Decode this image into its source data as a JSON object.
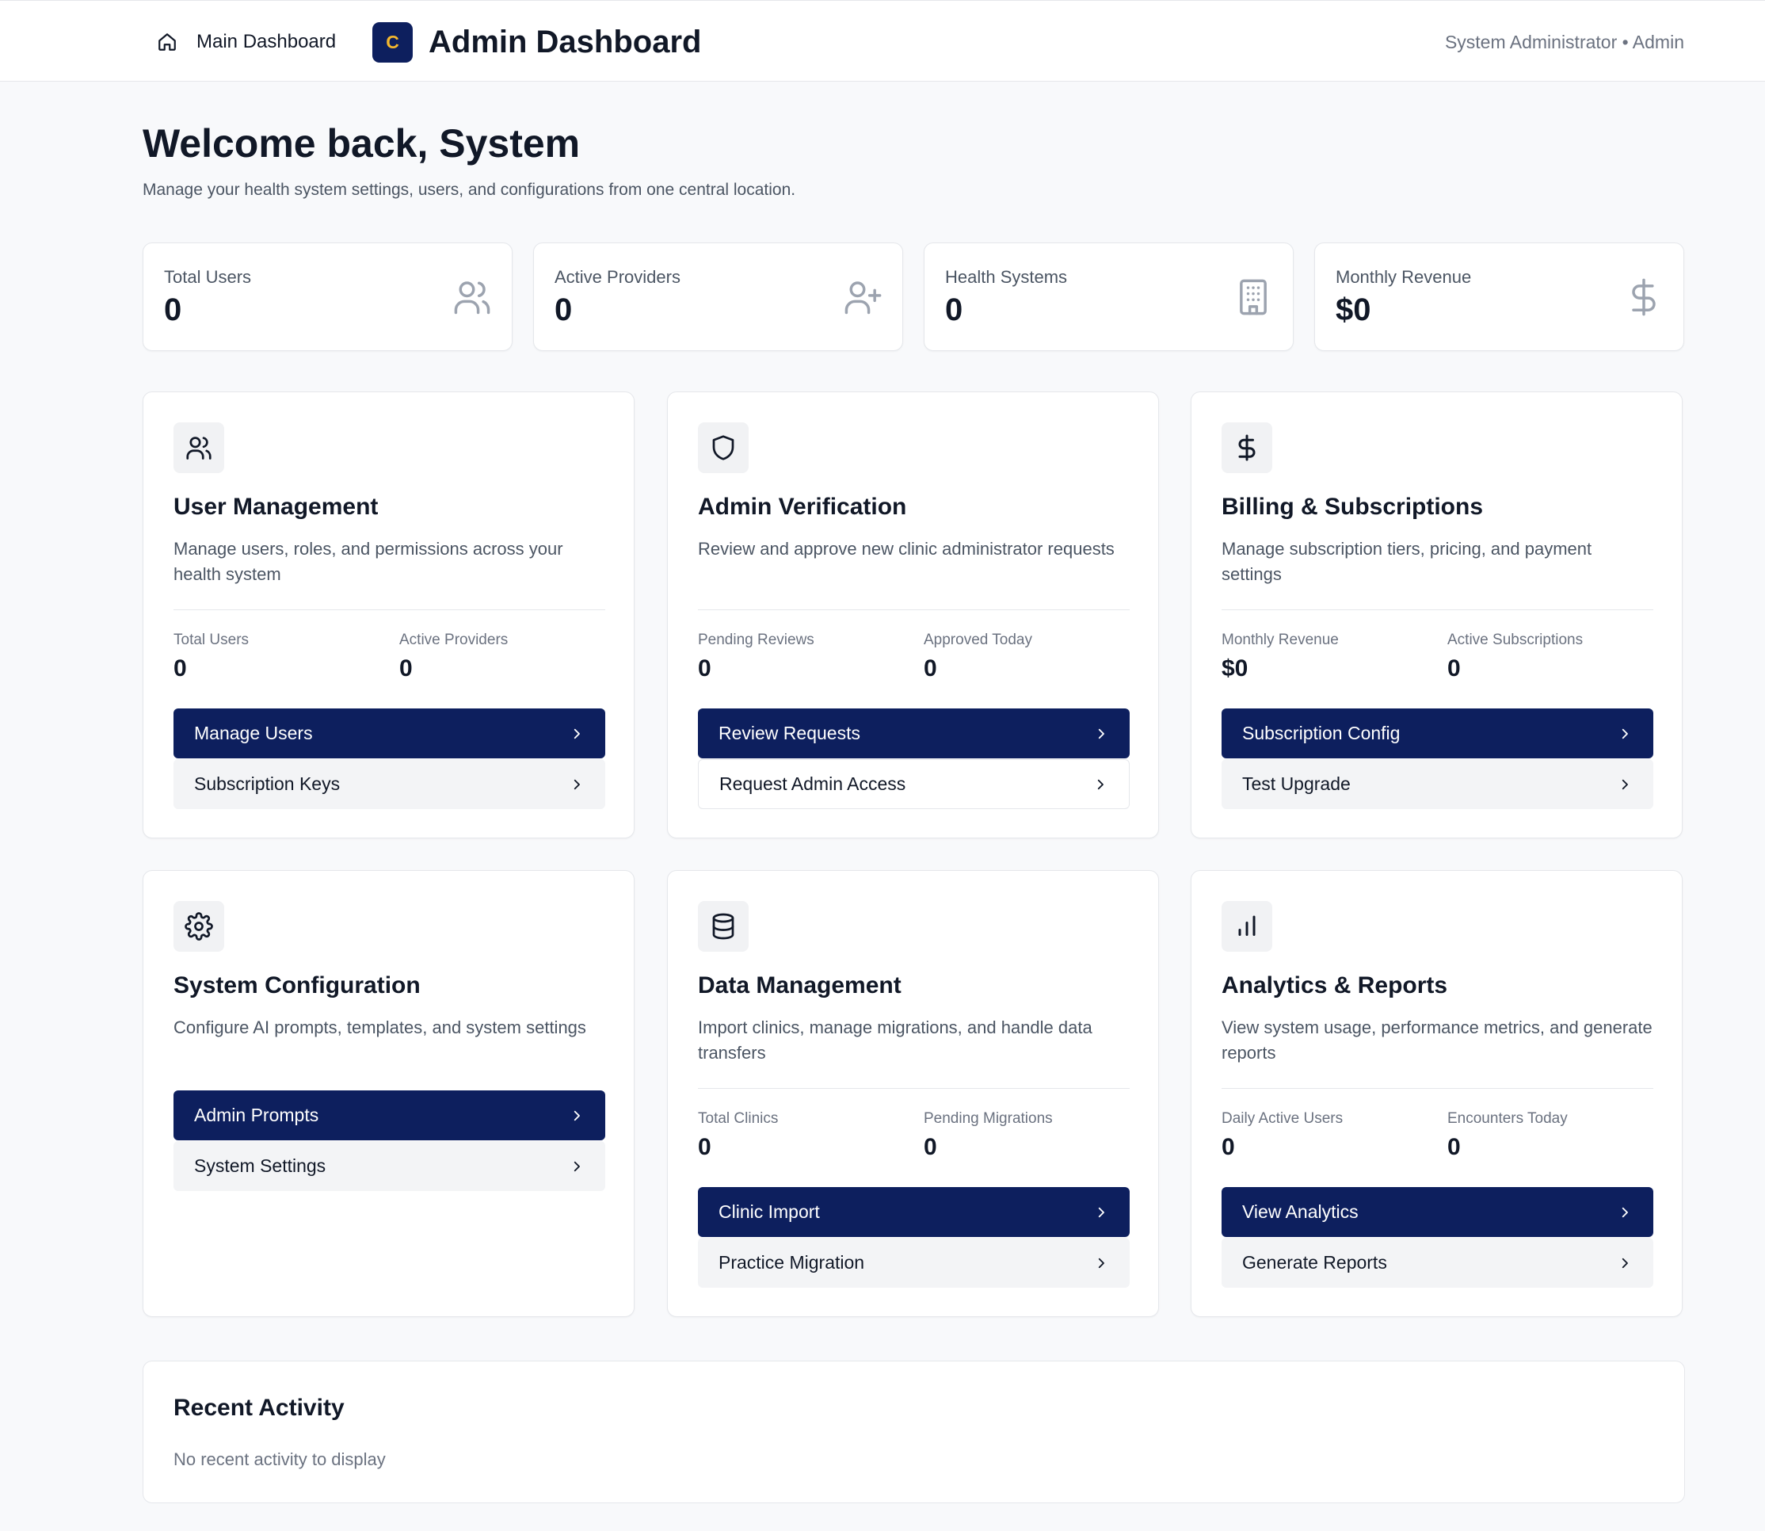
{
  "header": {
    "home_label": "Main Dashboard",
    "brand_letter": "C",
    "title": "Admin Dashboard",
    "user": "System Administrator • Admin",
    "brand_color": "#0d1f5e",
    "brand_letter_color": "#f5b82e"
  },
  "welcome": {
    "title": "Welcome back, System",
    "subtitle": "Manage your health system settings, users, and configurations from one central location."
  },
  "stats": [
    {
      "label": "Total Users",
      "value": "0",
      "icon": "users-icon"
    },
    {
      "label": "Active Providers",
      "value": "0",
      "icon": "user-plus-icon"
    },
    {
      "label": "Health Systems",
      "value": "0",
      "icon": "building-icon"
    },
    {
      "label": "Monthly Revenue",
      "value": "$0",
      "icon": "dollar-icon"
    }
  ],
  "cards": [
    {
      "icon": "users-icon",
      "title": "User Management",
      "desc": "Manage users, roles, and permissions across your health system",
      "stats": [
        {
          "label": "Total Users",
          "value": "0"
        },
        {
          "label": "Active Providers",
          "value": "0"
        }
      ],
      "primary": "Manage Users",
      "secondary": "Subscription Keys"
    },
    {
      "icon": "shield-icon",
      "title": "Admin Verification",
      "desc": "Review and approve new clinic administrator requests",
      "stats": [
        {
          "label": "Pending Reviews",
          "value": "0"
        },
        {
          "label": "Approved Today",
          "value": "0"
        }
      ],
      "primary": "Review Requests",
      "secondary": "Request Admin Access"
    },
    {
      "icon": "dollar-icon",
      "title": "Billing & Subscriptions",
      "desc": "Manage subscription tiers, pricing, and payment settings",
      "stats": [
        {
          "label": "Monthly Revenue",
          "value": "$0"
        },
        {
          "label": "Active Subscriptions",
          "value": "0"
        }
      ],
      "primary": "Subscription Config",
      "secondary": "Test Upgrade"
    },
    {
      "icon": "gear-icon",
      "title": "System Configuration",
      "desc": "Configure AI prompts, templates, and system settings",
      "stats": [],
      "primary": "Admin Prompts",
      "secondary": "System Settings"
    },
    {
      "icon": "database-icon",
      "title": "Data Management",
      "desc": "Import clinics, manage migrations, and handle data transfers",
      "stats": [
        {
          "label": "Total Clinics",
          "value": "0"
        },
        {
          "label": "Pending Migrations",
          "value": "0"
        }
      ],
      "primary": "Clinic Import",
      "secondary": "Practice Migration"
    },
    {
      "icon": "bar-chart-icon",
      "title": "Analytics & Reports",
      "desc": "View system usage, performance metrics, and generate reports",
      "stats": [
        {
          "label": "Daily Active Users",
          "value": "0"
        },
        {
          "label": "Encounters Today",
          "value": "0"
        }
      ],
      "primary": "View Analytics",
      "secondary": "Generate Reports"
    }
  ],
  "activity": {
    "title": "Recent Activity",
    "empty": "No recent activity to display"
  }
}
